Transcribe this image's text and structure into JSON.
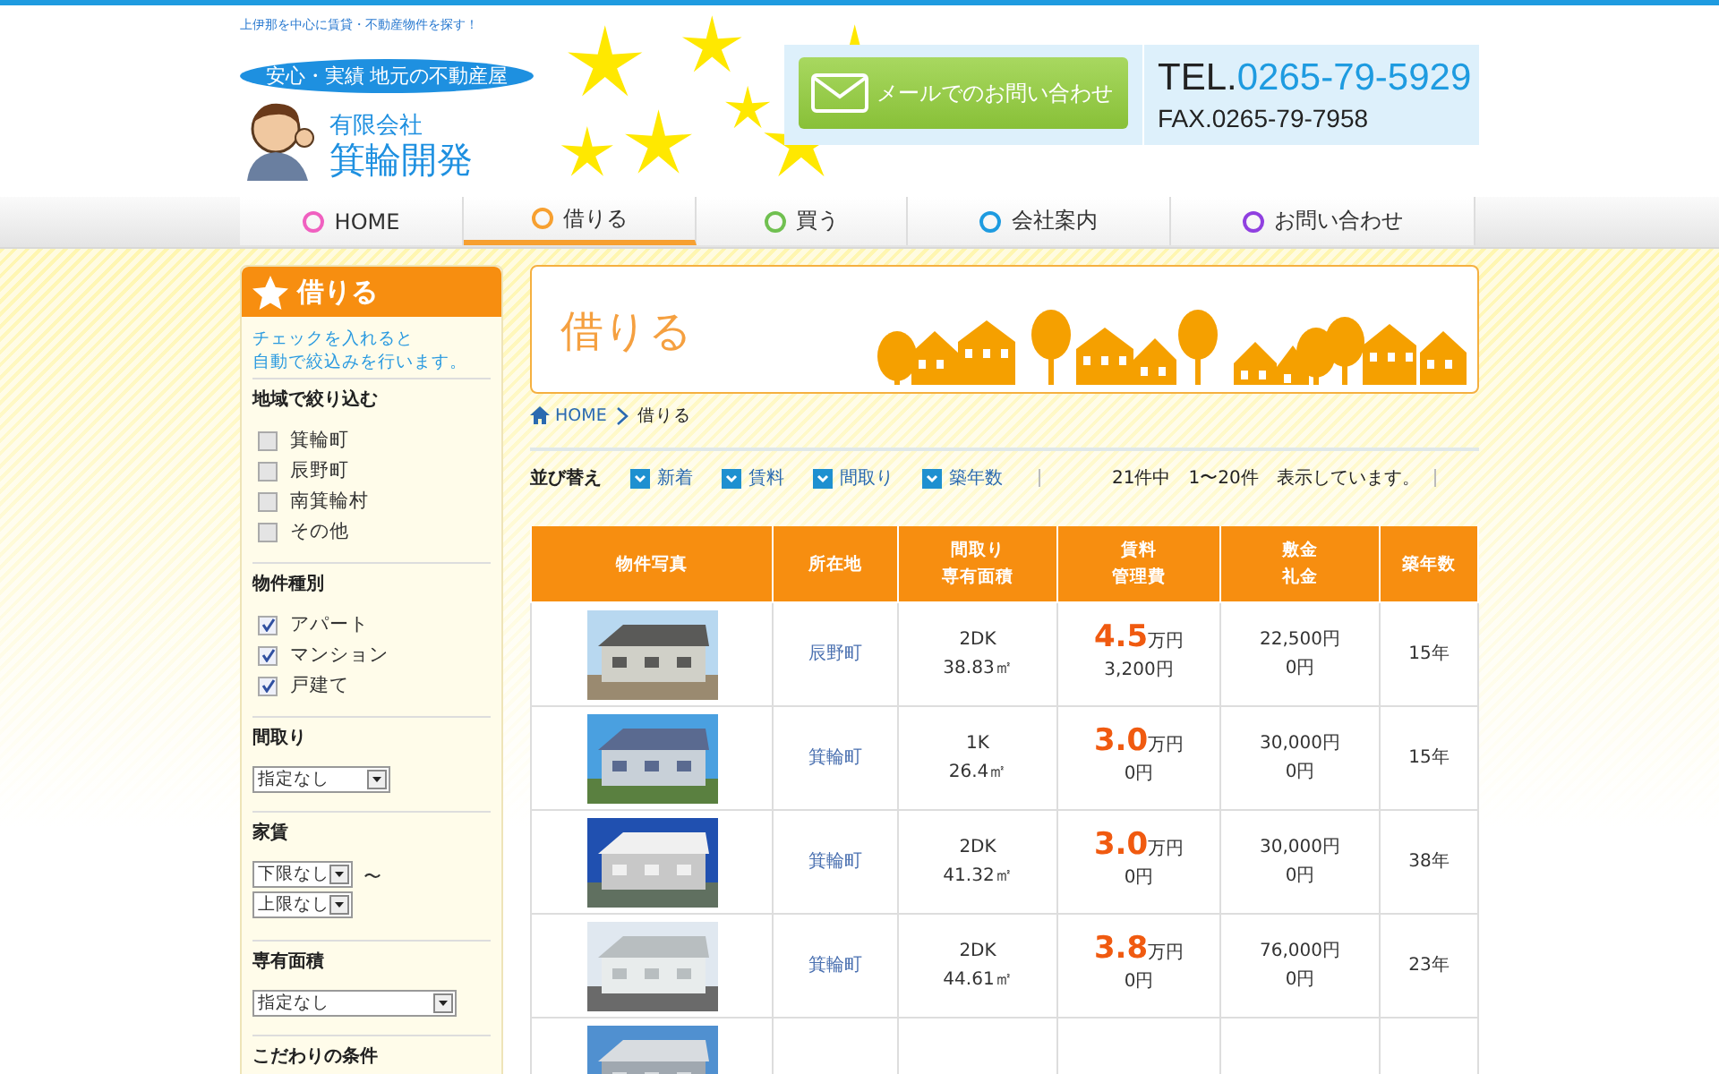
{
  "tagline": "上伊那を中心に賃貸・不動産物件を探す！",
  "header": {
    "badge": "安心・実績 地元の不動産屋",
    "company_type": "有限会社",
    "company_name": "箕輪開発",
    "mail_button": "メールでのお問い合わせ",
    "tel_label": "TEL.",
    "tel": "0265-79-5929",
    "fax": "FAX.0265-79-7958"
  },
  "nav": [
    {
      "label": "HOME",
      "color": "#f060c0",
      "selected": false
    },
    {
      "label": "借りる",
      "color": "#f7a030",
      "selected": true
    },
    {
      "label": "買う",
      "color": "#70c050",
      "selected": false
    },
    {
      "label": "会社案内",
      "color": "#1e9be0",
      "selected": false
    },
    {
      "label": "お問い合わせ",
      "color": "#9040e0",
      "selected": false
    }
  ],
  "sidebar": {
    "title": "借りる",
    "note": [
      "チェックを入れると",
      "自動で絞込みを行います。"
    ],
    "sections": [
      {
        "kind": "checkboxes",
        "title": "地域で絞り込む",
        "options": [
          {
            "label": "箕輪町",
            "checked": false
          },
          {
            "label": "辰野町",
            "checked": false
          },
          {
            "label": "南箕輪村",
            "checked": false
          },
          {
            "label": "その他",
            "checked": false
          }
        ]
      },
      {
        "kind": "checkboxes",
        "title": "物件種別",
        "options": [
          {
            "label": "アパート",
            "checked": true
          },
          {
            "label": "マンション",
            "checked": true
          },
          {
            "label": "戸建て",
            "checked": true
          }
        ]
      },
      {
        "kind": "select",
        "title": "間取り",
        "value": "指定なし"
      },
      {
        "kind": "range",
        "title": "家賃",
        "from": "下限なし",
        "separator": "〜",
        "to": "上限なし"
      },
      {
        "kind": "wide_select",
        "title": "専有面積",
        "value": "指定なし"
      },
      {
        "kind": "heading",
        "title": "こだわりの条件"
      }
    ]
  },
  "page_title": "借りる",
  "breadcrumb": [
    {
      "kind": "home",
      "label": "HOME"
    },
    {
      "kind": "current",
      "label": "借りる"
    }
  ],
  "sort": {
    "label": "並び替え",
    "options": [
      "新着",
      "賃料",
      "間取り",
      "築年数"
    ],
    "count": "21件中　1〜20件　表示しています。"
  },
  "table": {
    "columns": [
      [
        "物件写真"
      ],
      [
        "所在地"
      ],
      [
        "間取り",
        "専有面積"
      ],
      [
        "賃料",
        "管理費"
      ],
      [
        "敷金",
        "礼金"
      ],
      [
        "築年数"
      ]
    ],
    "rows": [
      {
        "photo": {
          "kind": "picture"
        },
        "location": "辰野町",
        "layout": "2DK",
        "area": "38.83㎡",
        "rent": "4.5",
        "rent_unit": "万円",
        "fee": "3,200円",
        "deposit": "22,500円",
        "key_money": "0円",
        "age": "15年"
      },
      {
        "photo": {
          "kind": "picture"
        },
        "location": "箕輪町",
        "layout": "1K",
        "area": "26.4㎡",
        "rent": "3.0",
        "rent_unit": "万円",
        "fee": "0円",
        "deposit": "30,000円",
        "key_money": "0円",
        "age": "15年"
      },
      {
        "photo": {
          "kind": "picture"
        },
        "location": "箕輪町",
        "layout": "2DK",
        "area": "41.32㎡",
        "rent": "3.0",
        "rent_unit": "万円",
        "fee": "0円",
        "deposit": "30,000円",
        "key_money": "0円",
        "age": "38年"
      },
      {
        "photo": {
          "kind": "picture"
        },
        "location": "箕輪町",
        "layout": "2DK",
        "area": "44.61㎡",
        "rent": "3.8",
        "rent_unit": "万円",
        "fee": "0円",
        "deposit": "76,000円",
        "key_money": "0円",
        "age": "23年"
      },
      {
        "photo": {
          "kind": "picture"
        }
      }
    ]
  }
}
